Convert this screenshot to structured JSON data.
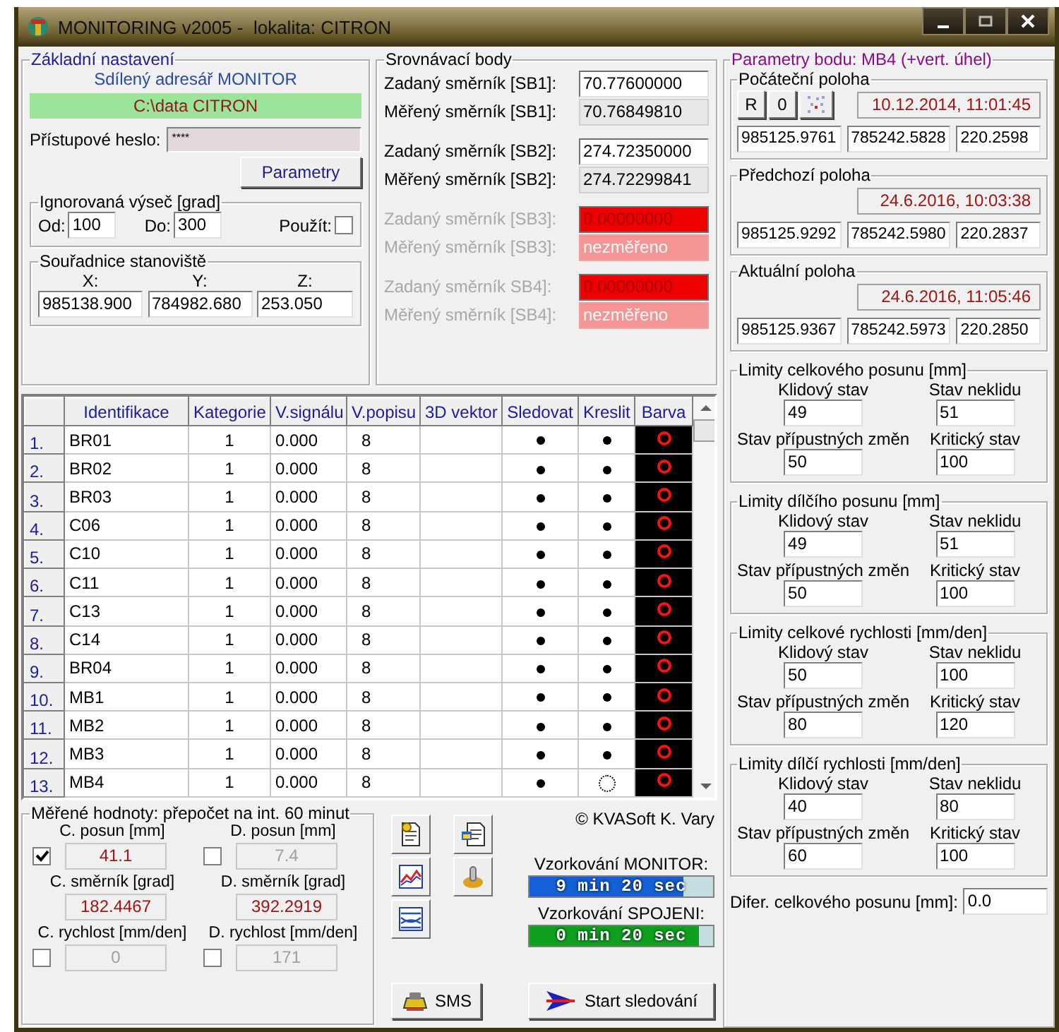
{
  "window": {
    "title": "MONITORING v2005 -  lokalita: CITRON"
  },
  "basic": {
    "title": "Základní nastavení",
    "dir_label": "Sdílený adresář MONITOR",
    "dir": "C:\\data CITRON",
    "password_label": "Přístupové heslo:",
    "password": "****",
    "params_button": "Parametry",
    "sector": {
      "title": "Ignorovaná výseč [grad]",
      "from_label": "Od:",
      "from": "100",
      "to_label": "Do:",
      "to": "300",
      "use_label": "Použít:",
      "use": false
    },
    "station": {
      "title": "Souřadnice stanoviště",
      "coords": [
        {
          "label": "X:",
          "value": "985138.900"
        },
        {
          "label": "Y:",
          "value": "784982.680"
        },
        {
          "label": "Z:",
          "value": "253.050"
        }
      ]
    }
  },
  "reference": {
    "title": "Srovnávací body",
    "groups": [
      {
        "disabled": false,
        "rows": [
          {
            "kind": "input",
            "label": "Zadaný směrník [SB1]:",
            "value": "70.77600000"
          },
          {
            "kind": "readout",
            "label": "Měřený směrník [SB1]:",
            "value": "70.76849810"
          }
        ]
      },
      {
        "disabled": false,
        "rows": [
          {
            "kind": "input",
            "label": "Zadaný směrník [SB2]:",
            "value": "274.72350000"
          },
          {
            "kind": "readout",
            "label": "Měřený směrník [SB2]:",
            "value": "274.72299841"
          }
        ]
      },
      {
        "disabled": true,
        "rows": [
          {
            "kind": "input",
            "label": "Zadaný směrník [SB3]:",
            "value": "0.00000000"
          },
          {
            "kind": "readout",
            "label": "Měřený směrník [SB3]:",
            "value": "nezměřeno"
          }
        ]
      },
      {
        "disabled": true,
        "rows": [
          {
            "kind": "input",
            "label": "Zadaný směrník SB4]:",
            "value": "0.00000000"
          },
          {
            "kind": "readout",
            "label": "Měřený směrník [SB4]:",
            "value": "nezměřeno"
          }
        ]
      }
    ]
  },
  "table": {
    "columns": [
      "Identifikace",
      "Kategorie",
      "V.signálu",
      "V.popisu",
      "3D vektor",
      "Sledovat",
      "Kreslit",
      "Barva"
    ],
    "rows": [
      {
        "number": "1.",
        "id": "BR01",
        "category": "1",
        "signal": "0.000",
        "label_size": "8",
        "track": true,
        "draw": true
      },
      {
        "number": "2.",
        "id": "BR02",
        "category": "1",
        "signal": "0.000",
        "label_size": "8",
        "track": true,
        "draw": true
      },
      {
        "number": "3.",
        "id": "BR03",
        "category": "1",
        "signal": "0.000",
        "label_size": "8",
        "track": true,
        "draw": true
      },
      {
        "number": "4.",
        "id": "C06",
        "category": "1",
        "signal": "0.000",
        "label_size": "8",
        "track": true,
        "draw": true
      },
      {
        "number": "5.",
        "id": "C10",
        "category": "1",
        "signal": "0.000",
        "label_size": "8",
        "track": true,
        "draw": true
      },
      {
        "number": "6.",
        "id": "C11",
        "category": "1",
        "signal": "0.000",
        "label_size": "8",
        "track": true,
        "draw": true
      },
      {
        "number": "7.",
        "id": "C13",
        "category": "1",
        "signal": "0.000",
        "label_size": "8",
        "track": true,
        "draw": true
      },
      {
        "number": "8.",
        "id": "C14",
        "category": "1",
        "signal": "0.000",
        "label_size": "8",
        "track": true,
        "draw": true
      },
      {
        "number": "9.",
        "id": "BR04",
        "category": "1",
        "signal": "0.000",
        "label_size": "8",
        "track": true,
        "draw": true
      },
      {
        "number": "10.",
        "id": "MB1",
        "category": "1",
        "signal": "0.000",
        "label_size": "8",
        "track": true,
        "draw": true
      },
      {
        "number": "11.",
        "id": "MB2",
        "category": "1",
        "signal": "0.000",
        "label_size": "8",
        "track": true,
        "draw": true
      },
      {
        "number": "12.",
        "id": "MB3",
        "category": "1",
        "signal": "0.000",
        "label_size": "8",
        "track": true,
        "draw": true
      },
      {
        "number": "13.",
        "id": "MB4",
        "category": "1",
        "signal": "0.000",
        "label_size": "8",
        "track": true,
        "draw": false
      }
    ]
  },
  "measured": {
    "title": "Měřené hodnoty: přepočet na int. 60 minut",
    "items": [
      {
        "kind": "checkbox",
        "label": "C. posun [mm]",
        "value": "41.1",
        "checked": true
      },
      {
        "kind": "checkbox",
        "label": "D. posun [mm]",
        "value": "7.4",
        "checked": false
      },
      {
        "kind": "plain",
        "label": "C. směrník [grad]",
        "value": "182.4467"
      },
      {
        "kind": "plain",
        "label": "D. směrník [grad]",
        "value": "392.2919"
      },
      {
        "kind": "checkbox",
        "label": "C. rychlost [mm/den]",
        "value": "0",
        "checked": false
      },
      {
        "kind": "checkbox",
        "label": "D. rychlost [mm/den]",
        "value": "171",
        "checked": false
      }
    ]
  },
  "sms_button": "SMS",
  "copyright": "© KVASoft K. Vary",
  "sampling": [
    {
      "label": "Vzorkování MONITOR:",
      "text": "9 min 20 sec",
      "level": 0.84,
      "color": "#1560d8"
    },
    {
      "label": "Vzorkování SPOJENI:",
      "text": "0 min 20 sec",
      "level": 0.92,
      "color": "#10a020"
    }
  ],
  "start_button": "Start sledování",
  "point": {
    "title": "Parametry bodu: MB4 (+vert. úhel)",
    "positions": [
      {
        "kind": "initial",
        "title": "Počáteční poloha",
        "buttons": [
          "R",
          "0"
        ],
        "timestamp": "10.12.2014, 11:01:45",
        "values": [
          "985125.9761",
          "785242.5828",
          "220.2598"
        ]
      },
      {
        "kind": "plain",
        "title": "Předchozí poloha",
        "timestamp": "24.6.2016, 10:03:38",
        "values": [
          "985125.9292",
          "785242.5980",
          "220.2837"
        ]
      },
      {
        "kind": "plain",
        "title": "Aktuální poloha",
        "timestamp": "24.6.2016, 11:05:46",
        "values": [
          "985125.9367",
          "785242.5973",
          "220.2850"
        ]
      }
    ],
    "limits": [
      {
        "title": "Limity celkového posunu [mm]",
        "fields": [
          {
            "label": "Klidový stav",
            "value": "49"
          },
          {
            "label": "Stav neklidu",
            "value": "51"
          },
          {
            "label": "Stav přípustných změn",
            "value": "50"
          },
          {
            "label": "Kritický stav",
            "value": "100"
          }
        ]
      },
      {
        "title": "Limity dílčího posunu [mm]",
        "fields": [
          {
            "label": "Klidový stav",
            "value": "49"
          },
          {
            "label": "Stav neklidu",
            "value": "51"
          },
          {
            "label": "Stav přípustných změn",
            "value": "50"
          },
          {
            "label": "Kritický stav",
            "value": "100"
          }
        ]
      },
      {
        "title": "Limity celkové rychlosti [mm/den]",
        "fields": [
          {
            "label": "Klidový stav",
            "value": "50"
          },
          {
            "label": "Stav neklidu",
            "value": "100"
          },
          {
            "label": "Stav přípustných změn",
            "value": "80"
          },
          {
            "label": "Kritický stav",
            "value": "120"
          }
        ]
      },
      {
        "title": "Limity dílčí rychlosti [mm/den]",
        "fields": [
          {
            "label": "Klidový stav",
            "value": "40"
          },
          {
            "label": "Stav neklidu",
            "value": "80"
          },
          {
            "label": "Stav přípustných změn",
            "value": "60"
          },
          {
            "label": "Kritický stav",
            "value": "100"
          }
        ]
      }
    ],
    "diff": {
      "label": "Difer. celkového posunu [mm]:",
      "value": "0.0"
    }
  }
}
